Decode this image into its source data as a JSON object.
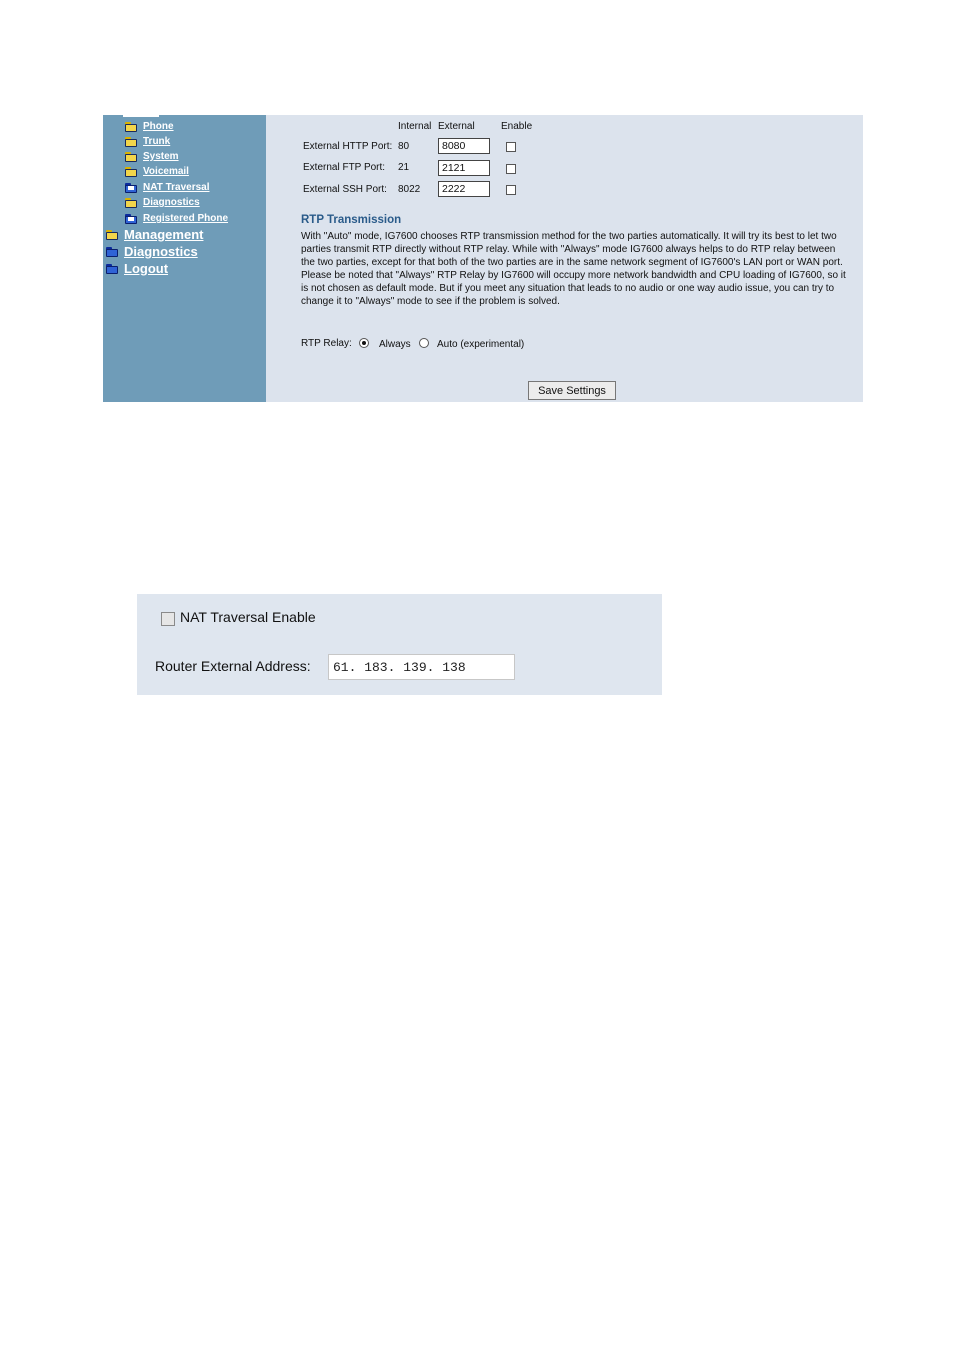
{
  "sidebar": {
    "sub_items": [
      {
        "label": "Phone",
        "icon": "folder-icon"
      },
      {
        "label": "Trunk",
        "icon": "folder-icon"
      },
      {
        "label": "System",
        "icon": "folder-icon"
      },
      {
        "label": "Voicemail",
        "icon": "folder-icon"
      },
      {
        "label": "NAT Traversal",
        "icon": "page-icon"
      },
      {
        "label": "Diagnostics",
        "icon": "folder-icon"
      },
      {
        "label": "Registered Phone",
        "icon": "page-icon"
      }
    ],
    "main_items": [
      {
        "label": "Management",
        "icon": "folder-icon"
      },
      {
        "label": "Diagnostics",
        "icon": "folder-icon"
      },
      {
        "label": "Logout",
        "icon": "folder-icon"
      }
    ]
  },
  "ports": {
    "headers": {
      "internal": "Internal",
      "external": "External",
      "enable": "Enable"
    },
    "rows": [
      {
        "label": "External HTTP Port:",
        "internal": "80",
        "external": "8080",
        "enabled": false
      },
      {
        "label": "External FTP Port:",
        "internal": "21",
        "external": "2121",
        "enabled": false
      },
      {
        "label": "External SSH Port:",
        "internal": "8022",
        "external": "2222",
        "enabled": false
      }
    ]
  },
  "rtp": {
    "heading": "RTP Transmission",
    "description": "With \"Auto\" mode, IG7600 chooses RTP transmission method for the two parties automatically. It will try its best to let two parties transmit RTP directly without RTP relay. While with \"Always\" mode IG7600 always helps to do RTP relay between the two parties, except for that both of the two parties are in the same network segment of IG7600's LAN port or WAN port. Please be noted that \"Always\" RTP Relay by IG7600 will occupy more network bandwidth and CPU loading of IG7600, so it is not chosen as default mode. But if you meet any situation that leads to no audio or one way audio issue, you can try to change it to \"Always\" mode to see if the problem is solved.",
    "relay_label": "RTP Relay:",
    "option_always": "Always",
    "option_auto": "Auto (experimental)",
    "selected": "Always"
  },
  "save_button": "Save Settings",
  "nat": {
    "enable_label": "NAT Traversal Enable",
    "enabled": false,
    "address_label": "Router External Address:",
    "address_value": "61. 183. 139. 138"
  },
  "colors": {
    "sidebar": "#6f9cb8",
    "content_bg": "#dce3ed",
    "heading": "#2a5b8a",
    "panel_bg": "#dfe6ef"
  }
}
